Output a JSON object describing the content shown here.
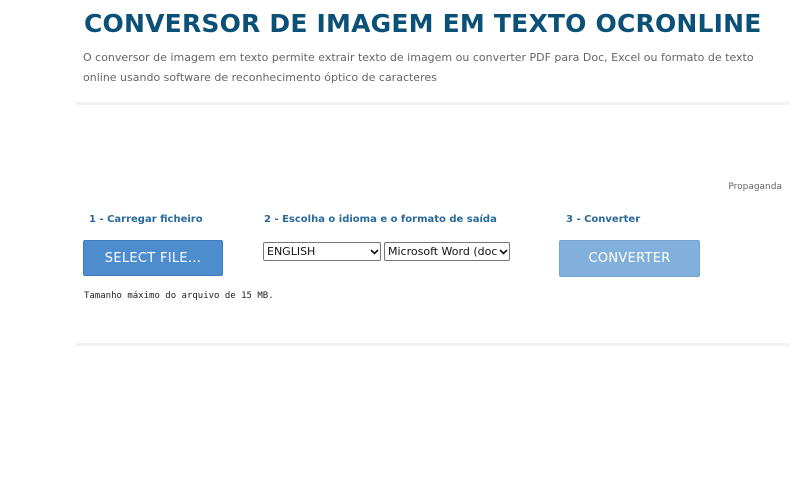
{
  "header": {
    "title": "CONVERSOR DE IMAGEM EM TEXTO OCRONLINE",
    "subtitle": "O conversor de imagem em texto permite extrair texto de imagem ou converter PDF para Doc, Excel ou formato de texto online usando software de reconhecimento óptico de caracteres"
  },
  "ad": {
    "label": "Propaganda"
  },
  "steps": {
    "step1_label": "1 - Carregar ficheiro",
    "step2_label": "2 - Escolha o idioma e o formato de saída",
    "step3_label": "3 - Converter"
  },
  "upload": {
    "select_button_label": "SELECT FILE...",
    "max_size_text": "Tamanho máximo do arquivo de 15 MB."
  },
  "options": {
    "language_value": "ENGLISH",
    "format_value": "Microsoft Word (docx)"
  },
  "convert": {
    "button_label": "CONVERTER"
  },
  "colors": {
    "title": "#0b5077",
    "step_label": "#2a6a9b",
    "select_button": "#4d8ccd",
    "convert_button": "#81b0dd"
  },
  "icons": {
    "dropdown": "chevron-down-icon"
  }
}
